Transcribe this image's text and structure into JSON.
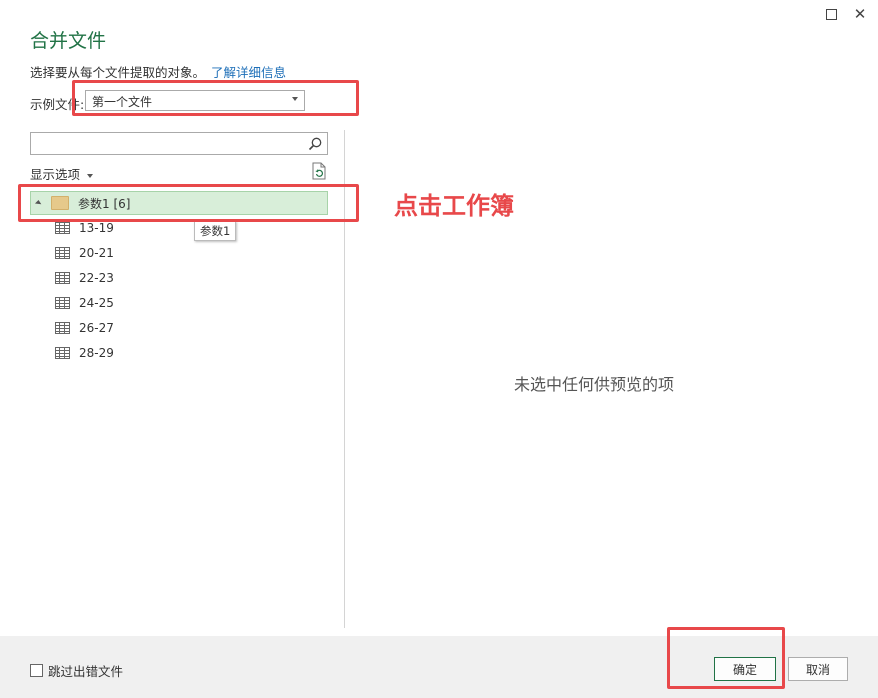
{
  "window": {
    "title": "合并文件",
    "description": "选择要从每个文件提取的对象。",
    "learn_more_link": "了解详细信息"
  },
  "example_file": {
    "label": "示例文件:",
    "selected": "第一个文件"
  },
  "search": {
    "placeholder": ""
  },
  "display_options": {
    "label": "显示选项"
  },
  "tree": {
    "root_label": "参数1 [6]",
    "tooltip": "参数1",
    "items": [
      "13-19",
      "20-21",
      "22-23",
      "24-25",
      "26-27",
      "28-29"
    ]
  },
  "preview": {
    "empty_message": "未选中任何供预览的项"
  },
  "footer": {
    "skip_errors_label": "跳过出错文件",
    "ok_label": "确定",
    "cancel_label": "取消"
  },
  "annotation": {
    "text": "点击工作簿",
    "color": "#e8484a"
  },
  "colors": {
    "accent": "#217346",
    "link": "#1e6fb8",
    "selected_row": "#d8eed9"
  }
}
